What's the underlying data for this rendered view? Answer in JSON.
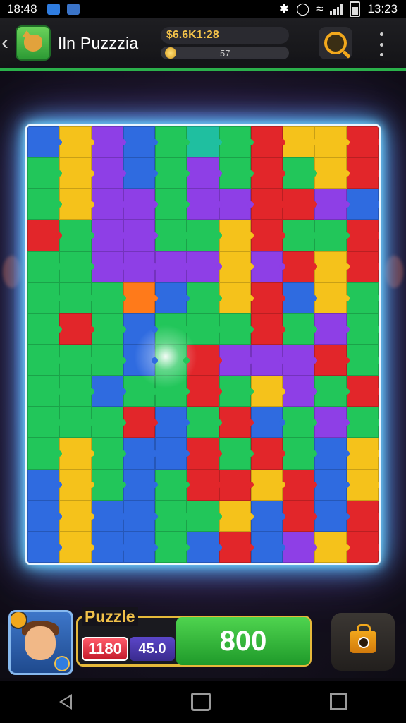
{
  "status_bar": {
    "time_left": "18:48",
    "time_right": "13:23"
  },
  "header": {
    "title": "Iln Puzzzia",
    "score": "$6.6K1:28",
    "coins": "57"
  },
  "board": {
    "columns": 11,
    "rows": 14,
    "colors": {
      "B": "#2f6be0",
      "Y": "#f5c21b",
      "P": "#8e3fe6",
      "G": "#22c65a",
      "R": "#e2262a",
      "T": "#1fbfa0",
      "O": "#ff7a1a"
    },
    "grid": [
      "BYPBGTGRYYR",
      "GYPBGPGRGYR",
      "GYPPGPPRRPB",
      "RGPPGGYRGGR",
      "GGPPPPYPRYR",
      "GGGOBGYRBYG",
      "GRGBGGGRGPG",
      "GGGBGRPPPRG",
      "GGBGGRGYPGR",
      "GGGRBGRBGPG",
      "GYGBBRGRGBY",
      "BYGBGRRYRBY",
      "BYBBGGYBRBR",
      "BYBBGBRBPYR"
    ]
  },
  "hud": {
    "title": "Puzzle",
    "level": "1180",
    "moves": "45.0",
    "points": "800"
  }
}
